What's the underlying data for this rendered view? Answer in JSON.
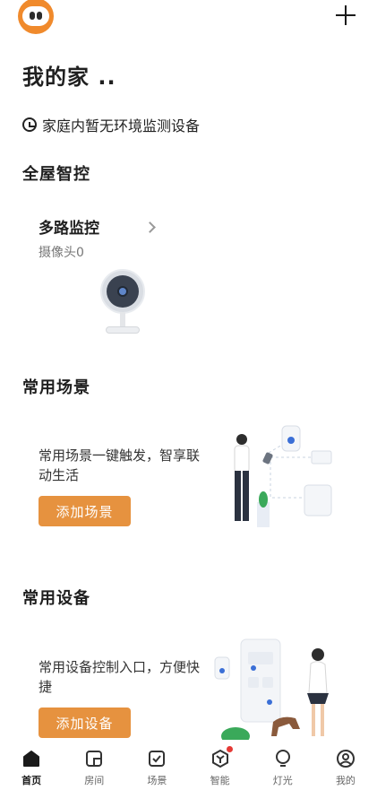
{
  "home": {
    "title": "我的家 ..",
    "env_status": "家庭内暂无环境监测设备"
  },
  "whole_house": {
    "title": "全屋智控",
    "card": {
      "name": "多路监控",
      "subtitle": "摄像头0"
    }
  },
  "scenes": {
    "title": "常用场景",
    "description": "常用场景一键触发，智享联动生活",
    "button": "添加场景"
  },
  "devices": {
    "title": "常用设备",
    "description": "常用设备控制入口，方便快捷",
    "button": "添加设备"
  },
  "bottom_nav": [
    {
      "label": "首页",
      "icon": "home-icon",
      "active": true
    },
    {
      "label": "房间",
      "icon": "room-icon",
      "active": false
    },
    {
      "label": "场景",
      "icon": "scene-check-icon",
      "active": false
    },
    {
      "label": "智能",
      "icon": "smart-hexagon-icon",
      "active": false,
      "badge": true
    },
    {
      "label": "灯光",
      "icon": "bulb-icon",
      "active": false
    },
    {
      "label": "我的",
      "icon": "profile-icon",
      "active": false
    }
  ],
  "colors": {
    "accent": "#e6923f",
    "avatar": "#f08a2c",
    "badge": "#e53935"
  }
}
